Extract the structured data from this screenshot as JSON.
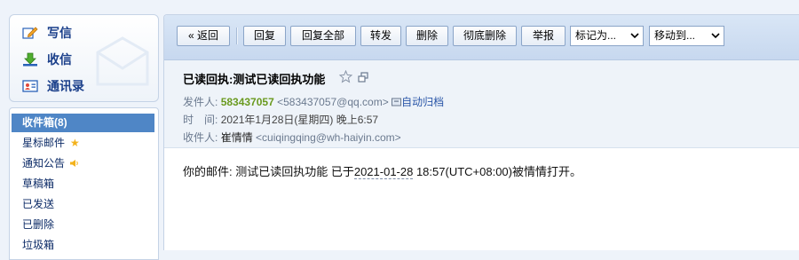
{
  "sidebar": {
    "actions": {
      "write": "写信",
      "receive": "收信",
      "contacts": "通讯录"
    },
    "folders": [
      {
        "label": "收件箱(8)",
        "active": true
      },
      {
        "label": "星标邮件"
      },
      {
        "label": "通知公告"
      },
      {
        "label": "草稿箱"
      },
      {
        "label": "已发送"
      },
      {
        "label": "已删除"
      },
      {
        "label": "垃圾箱"
      }
    ]
  },
  "toolbar": {
    "back": "« 返回",
    "reply": "回复",
    "reply_all": "回复全部",
    "forward": "转发",
    "delete": "删除",
    "delete_permanently": "彻底删除",
    "report": "举报",
    "mark_as": "标记为...",
    "move_to": "移动到..."
  },
  "mail": {
    "subject": "已读回执:测试已读回执功能",
    "from_label": "发件人:",
    "from_name": "583437057",
    "from_address": "<583437057@qq.com>",
    "auto_archive": "自动归档",
    "time_label": "时　间:",
    "time_value": "2021年1月28日(星期四) 晚上6:57",
    "to_label": "收件人:",
    "to_name": "崔情情",
    "to_address": "<cuiqingqing@wh-haiyin.com>",
    "body_prefix": "你的邮件: 测试已读回执功能 已于",
    "body_date": "2021-01-28",
    "body_suffix": " 18:57(UTC+08:00)被情情打开。"
  },
  "colors": {
    "accent": "#4f86c6",
    "toolbar": "#c7d8ef",
    "sender_name": "#6a9a1f"
  }
}
